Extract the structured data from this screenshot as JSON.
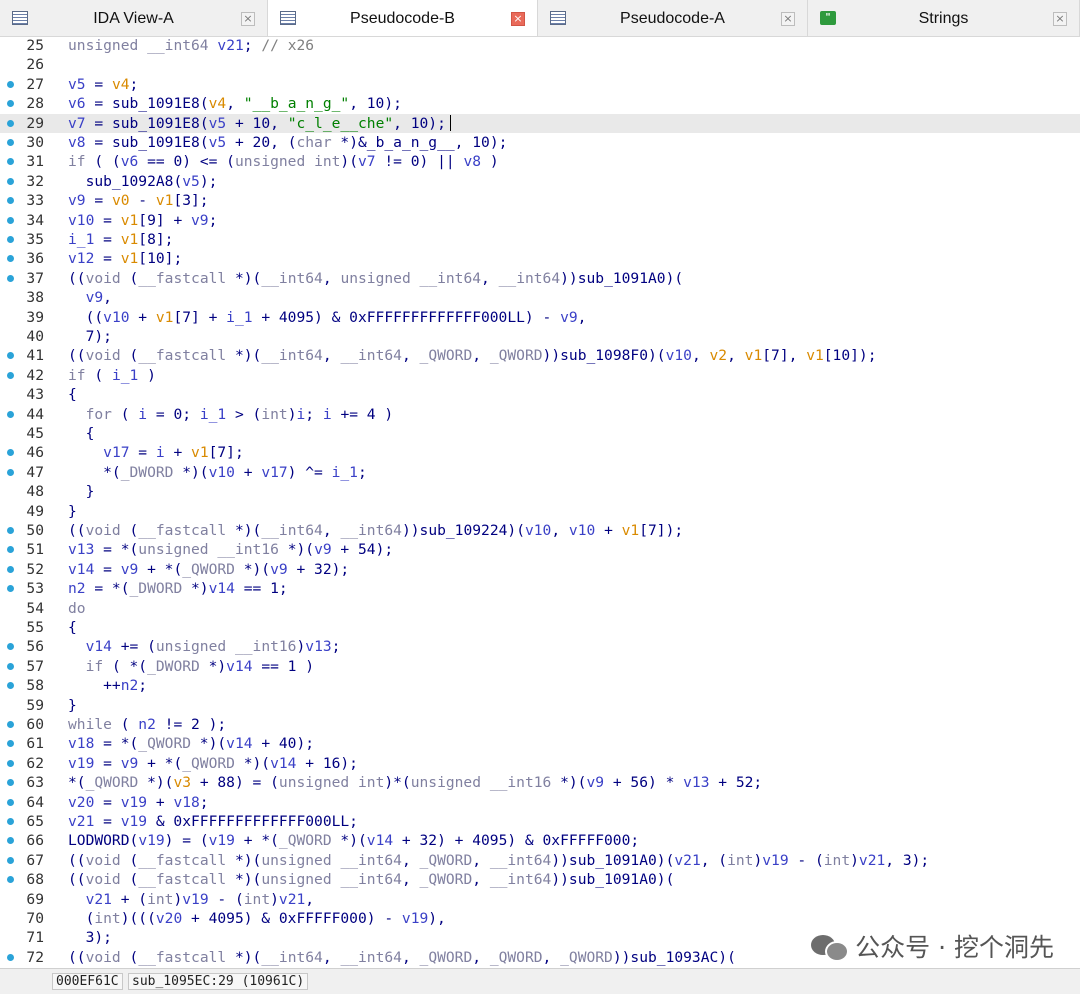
{
  "tabs": [
    {
      "label": "IDA View-A",
      "icon": "ida-view-icon",
      "active": false
    },
    {
      "label": "Pseudocode-B",
      "icon": "pseudocode-icon",
      "active": true
    },
    {
      "label": "Pseudocode-A",
      "icon": "pseudocode-icon",
      "active": false
    },
    {
      "label": "Strings",
      "icon": "strings-icon",
      "active": false
    }
  ],
  "close_glyph": "×",
  "strings_glyph": "\"",
  "code_lines": [
    {
      "num": "25",
      "dot": false,
      "text": "unsigned __int64 v21; // x26"
    },
    {
      "num": "26",
      "dot": false,
      "text": ""
    },
    {
      "num": "27",
      "dot": true,
      "text": "v5 = v4;"
    },
    {
      "num": "28",
      "dot": true,
      "text": "v6 = sub_1091E8(v4, \"__b_a_n_g_\", 10);"
    },
    {
      "num": "29",
      "dot": true,
      "text": "v7 = sub_1091E8(v5 + 10, \"c_l_e__che\", 10);"
    },
    {
      "num": "30",
      "dot": true,
      "text": "v8 = sub_1091E8(v5 + 20, (char *)&_b_a_n_g__, 10);"
    },
    {
      "num": "31",
      "dot": true,
      "text": "if ( (v6 == 0) <= (unsigned int)(v7 != 0) || v8 )"
    },
    {
      "num": "32",
      "dot": true,
      "text": "  sub_1092A8(v5);"
    },
    {
      "num": "33",
      "dot": true,
      "text": "v9 = v0 - v1[3];"
    },
    {
      "num": "34",
      "dot": true,
      "text": "v10 = v1[9] + v9;"
    },
    {
      "num": "35",
      "dot": true,
      "text": "i_1 = v1[8];"
    },
    {
      "num": "36",
      "dot": true,
      "text": "v12 = v1[10];"
    },
    {
      "num": "37",
      "dot": true,
      "text": "((void (__fastcall *)(__int64, unsigned __int64, __int64))sub_1091A0)("
    },
    {
      "num": "38",
      "dot": false,
      "text": "  v9,"
    },
    {
      "num": "39",
      "dot": false,
      "text": "  ((v10 + v1[7] + i_1 + 4095) & 0xFFFFFFFFFFFFF000LL) - v9,"
    },
    {
      "num": "40",
      "dot": false,
      "text": "  7);"
    },
    {
      "num": "41",
      "dot": true,
      "text": "((void (__fastcall *)(__int64, __int64, _QWORD, _QWORD))sub_1098F0)(v10, v2, v1[7], v1[10]);"
    },
    {
      "num": "42",
      "dot": true,
      "text": "if ( i_1 )"
    },
    {
      "num": "43",
      "dot": false,
      "text": "{"
    },
    {
      "num": "44",
      "dot": true,
      "text": "  for ( i = 0; i_1 > (int)i; i += 4 )"
    },
    {
      "num": "45",
      "dot": false,
      "text": "  {"
    },
    {
      "num": "46",
      "dot": true,
      "text": "    v17 = i + v1[7];"
    },
    {
      "num": "47",
      "dot": true,
      "text": "    *(_DWORD *)(v10 + v17) ^= i_1;"
    },
    {
      "num": "48",
      "dot": false,
      "text": "  }"
    },
    {
      "num": "49",
      "dot": false,
      "text": "}"
    },
    {
      "num": "50",
      "dot": true,
      "text": "((void (__fastcall *)(__int64, __int64))sub_109224)(v10, v10 + v1[7]);"
    },
    {
      "num": "51",
      "dot": true,
      "text": "v13 = *(unsigned __int16 *)(v9 + 54);"
    },
    {
      "num": "52",
      "dot": true,
      "text": "v14 = v9 + *(_QWORD *)(v9 + 32);"
    },
    {
      "num": "53",
      "dot": true,
      "text": "n2 = *(_DWORD *)v14 == 1;"
    },
    {
      "num": "54",
      "dot": false,
      "text": "do"
    },
    {
      "num": "55",
      "dot": false,
      "text": "{"
    },
    {
      "num": "56",
      "dot": true,
      "text": "  v14 += (unsigned __int16)v13;"
    },
    {
      "num": "57",
      "dot": true,
      "text": "  if ( *(_DWORD *)v14 == 1 )"
    },
    {
      "num": "58",
      "dot": true,
      "text": "    ++n2;"
    },
    {
      "num": "59",
      "dot": false,
      "text": "}"
    },
    {
      "num": "60",
      "dot": true,
      "text": "while ( n2 != 2 );"
    },
    {
      "num": "61",
      "dot": true,
      "text": "v18 = *(_QWORD *)(v14 + 40);"
    },
    {
      "num": "62",
      "dot": true,
      "text": "v19 = v9 + *(_QWORD *)(v14 + 16);"
    },
    {
      "num": "63",
      "dot": true,
      "text": "*(_QWORD *)(v3 + 88) = (unsigned int)*(unsigned __int16 *)(v9 + 56) * v13 + 52;"
    },
    {
      "num": "64",
      "dot": true,
      "text": "v20 = v19 + v18;"
    },
    {
      "num": "65",
      "dot": true,
      "text": "v21 = v19 & 0xFFFFFFFFFFFFF000LL;"
    },
    {
      "num": "66",
      "dot": true,
      "text": "LODWORD(v19) = (v19 + *(_QWORD *)(v14 + 32) + 4095) & 0xFFFFF000;"
    },
    {
      "num": "67",
      "dot": true,
      "text": "((void (__fastcall *)(unsigned __int64, _QWORD, __int64))sub_1091A0)(v21, (int)v19 - (int)v21, 3);"
    },
    {
      "num": "68",
      "dot": true,
      "text": "((void (__fastcall *)(unsigned __int64, _QWORD, __int64))sub_1091A0)("
    },
    {
      "num": "69",
      "dot": false,
      "text": "  v21 + (int)v19 - (int)v21,"
    },
    {
      "num": "70",
      "dot": false,
      "text": "  (int)(((v20 + 4095) & 0xFFFFF000) - v19),"
    },
    {
      "num": "71",
      "dot": false,
      "text": "  3);"
    },
    {
      "num": "72",
      "dot": true,
      "text": "((void (__fastcall *)(__int64, __int64, _QWORD, _QWORD, _QWORD))sub_1093AC)("
    }
  ],
  "highlighted_line": "29",
  "status": {
    "address": "000EF61C",
    "location": "sub_1095EC:29 (10961C)"
  },
  "watermark": "公众号 · 挖个洞先",
  "colors": {
    "accent": "#2aa3d8",
    "variable": "#3a40c7",
    "string": "#008000",
    "keyword": "#000080",
    "close_active": "#e96a5a"
  }
}
